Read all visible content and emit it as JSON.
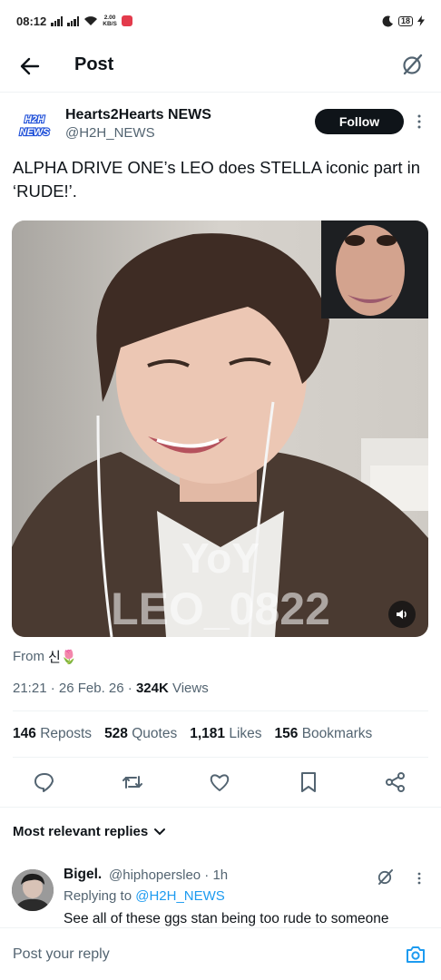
{
  "status_bar": {
    "time": "08:12",
    "net_speed_value": "2.00",
    "net_speed_unit": "KB/S",
    "battery": "18"
  },
  "header": {
    "title": "Post",
    "back_icon": "arrow-left-icon",
    "grok_icon": "grok-icon"
  },
  "author": {
    "logo_text_top": "H2H",
    "logo_text_bottom": "NEWS",
    "name": "Hearts2Hearts NEWS",
    "handle": "@H2H_NEWS",
    "follow_label": "Follow"
  },
  "post": {
    "text": "ALPHA DRIVE ONE’s LEO does STELLA iconic part in ‘RUDE!’.",
    "media": {
      "watermark_top": "YoY",
      "watermark_bottom": "LEO_0822"
    },
    "from_label": "From",
    "from_name": "신🌷",
    "time": "21:21",
    "date": "26 Feb. 26",
    "views_count": "324K",
    "views_label": "Views"
  },
  "stats": [
    {
      "count": "146",
      "label": "Reposts"
    },
    {
      "count": "528",
      "label": "Quotes"
    },
    {
      "count": "1,181",
      "label": "Likes"
    },
    {
      "count": "156",
      "label": "Bookmarks"
    }
  ],
  "actions": [
    "reply-icon",
    "repost-icon",
    "like-icon",
    "bookmark-icon",
    "share-icon"
  ],
  "replies": {
    "sort_label": "Most relevant replies",
    "items": [
      {
        "name": "Bigel.",
        "handle": "@hiphopersleo · 1h",
        "replying_label": "Replying to",
        "replying_to": "@H2H_NEWS",
        "text": "See all of these ggs stan being too rude to someone"
      }
    ]
  },
  "composer": {
    "placeholder": "Post your reply"
  },
  "colors": {
    "accent": "#1d9bf0",
    "text": "#0f1419",
    "muted": "#536471",
    "follow_bg": "#0f1419"
  }
}
